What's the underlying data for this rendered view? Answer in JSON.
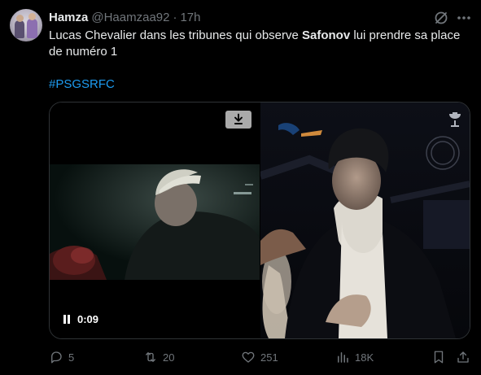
{
  "author": {
    "name": "Hamza",
    "handle": "@Haamzaa92",
    "separator": "·",
    "time": "17h"
  },
  "tweet": {
    "text_part1": "Lucas Chevalier dans les tribunes qui observe ",
    "text_bold": "Safonov",
    "text_part2": " lui prendre sa place de numéro 1",
    "hashtag": "#PSGSRFC"
  },
  "video": {
    "elapsed": "0:09"
  },
  "actions": {
    "replies": "5",
    "reposts": "20",
    "likes": "251",
    "views": "18K"
  },
  "colors": {
    "background": "#000000",
    "text": "#e7e9ea",
    "muted": "#71767b",
    "accent": "#1d9bf0"
  },
  "icons": [
    "grok-icon",
    "more-icon",
    "download-icon",
    "pause-icon",
    "reply-icon",
    "repost-icon",
    "like-icon",
    "views-icon",
    "bookmark-icon",
    "share-icon"
  ]
}
